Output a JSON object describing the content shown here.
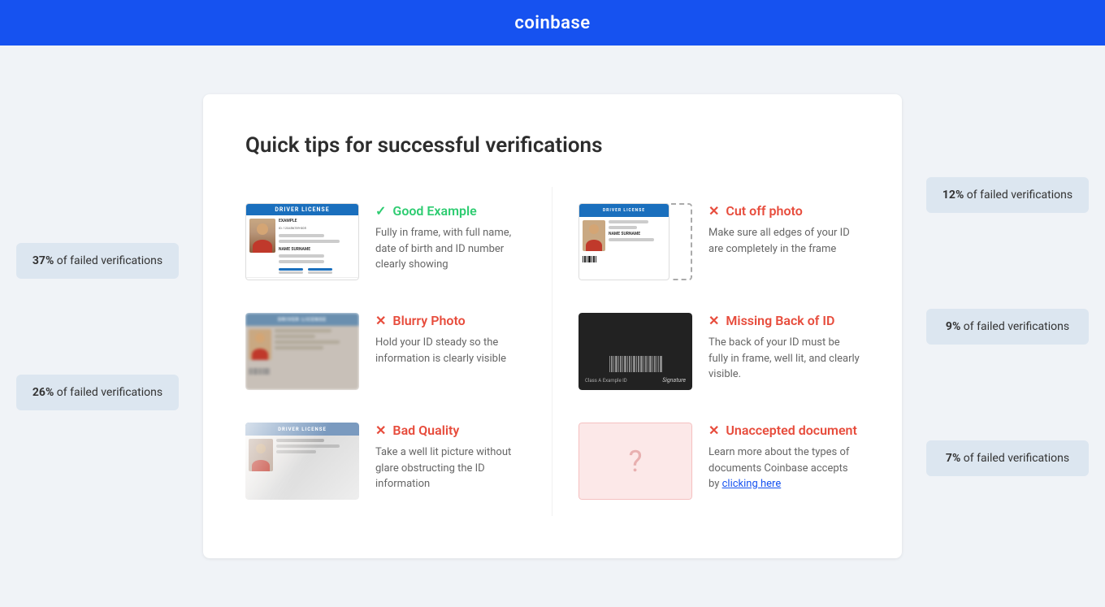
{
  "header": {
    "logo": "coinbase"
  },
  "page": {
    "title": "Quick tips for successful verifications"
  },
  "left_badges": [
    {
      "percent": "37%",
      "label": "of failed verifications"
    },
    {
      "percent": "26%",
      "label": "of failed verifications"
    }
  ],
  "right_badges": [
    {
      "percent": "12%",
      "label": "of failed verifications"
    },
    {
      "percent": "9%",
      "label": "of failed verifications"
    },
    {
      "percent": "7%",
      "label": "of failed verifications"
    }
  ],
  "tips": [
    {
      "id": "good-example",
      "type": "good",
      "icon": "check",
      "title": "Good Example",
      "description": "Fully in frame, with full name, date of birth and ID number clearly showing",
      "image_type": "good"
    },
    {
      "id": "cut-off-photo",
      "type": "bad",
      "icon": "x",
      "title": "Cut off photo",
      "description": "Make sure all edges of your ID are completely in the frame",
      "image_type": "cutoff"
    },
    {
      "id": "blurry-photo",
      "type": "bad",
      "icon": "x",
      "title": "Blurry Photo",
      "description": "Hold your ID steady so the information is clearly visible",
      "image_type": "blurry"
    },
    {
      "id": "missing-back",
      "type": "bad",
      "icon": "x",
      "title": "Missing Back of ID",
      "description": "The back of your ID must be fully in frame, well lit, and clearly visible.",
      "image_type": "back"
    },
    {
      "id": "bad-quality",
      "type": "bad",
      "icon": "x",
      "title": "Bad Quality",
      "description": "Take a well lit picture without glare obstructing the ID information",
      "image_type": "quality"
    },
    {
      "id": "unaccepted-document",
      "type": "bad",
      "icon": "x",
      "title": "Unaccepted document",
      "description": "Learn more about the types of documents Coinbase accepts by ",
      "link_text": "clicking here",
      "image_type": "unknown"
    }
  ],
  "id_card": {
    "header_text": "DRIVER LICENSE",
    "example_text": "EXAMPLE",
    "id_label": "ID: 123456789-005",
    "name_label": "NAME SURNAME"
  }
}
